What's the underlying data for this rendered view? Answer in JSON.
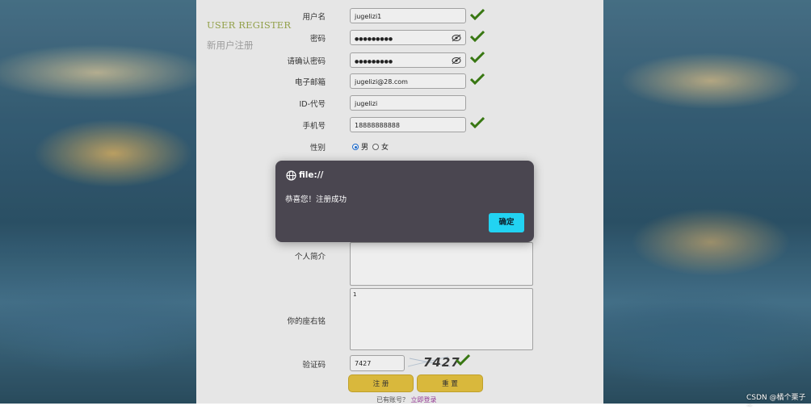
{
  "side": {
    "title_en": "USER REGISTER",
    "title_cn": "新用户注册"
  },
  "form": {
    "username": {
      "label": "用户名",
      "value": "jugelizi1"
    },
    "password": {
      "label": "密码",
      "value": "●●●●●●●●●"
    },
    "confirm": {
      "label": "请确认密码",
      "value": "●●●●●●●●●"
    },
    "email": {
      "label": "电子邮箱",
      "value": "jugelizi@28.com"
    },
    "idcode": {
      "label": "ID-代号",
      "value": "jugelizi"
    },
    "phone": {
      "label": "手机号",
      "value": "18888888888"
    },
    "gender": {
      "label": "性别",
      "male": "男",
      "female": "女",
      "selected": "男"
    },
    "bio": {
      "label": "个人简介",
      "value": ""
    },
    "motto": {
      "label": "你的座右铭",
      "value": "1"
    },
    "captcha": {
      "label": "验证码",
      "value": "7427",
      "image_text": "7427"
    },
    "register_button": "注 册",
    "reset_button": "重 置"
  },
  "footer": {
    "text": "已有账号？",
    "link": "立即登录"
  },
  "dialog": {
    "title": "file://",
    "message": "恭喜您！注册成功",
    "ok": "确定"
  },
  "watermark": "CSDN @橘个栗子~",
  "colors": {
    "check": "#3a7d12",
    "button": "#e5c23e",
    "dialog_bg": "#4a4650",
    "dialog_button": "#22d3f2",
    "title_en": "#9aa84c"
  },
  "icons": {
    "check": "check-icon",
    "eye": "eye-off-icon",
    "globe": "globe-icon"
  }
}
